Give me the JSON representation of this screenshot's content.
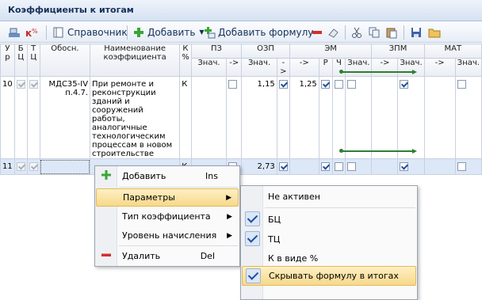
{
  "window": {
    "title": "Коэффициенты к итогам"
  },
  "toolbar": {
    "reference_label": "Справочник",
    "add_label": "Добавить",
    "add_formula_label": "Добавить формулу"
  },
  "grid": {
    "headers": {
      "ur": "У р",
      "bc": "Б Ц",
      "tc": "Т Ц",
      "obosn": "Обосн.",
      "name": "Наименование коэффициента",
      "kpct": "К %",
      "pz": "ПЗ",
      "ozp": "ОЗП",
      "em": "ЭМ",
      "zpm": "ЗПМ",
      "mat": "МАТ",
      "znach": "Знач.",
      "arrow": "->",
      "r": "Р",
      "ch": "Ч"
    },
    "rows": [
      {
        "ur": "10",
        "obosn": "МДС35-IV п.4.7.",
        "name": "При ремонте и реконструкции зданий и сооружений работы, аналогичные технологическим процессам в новом строительстве",
        "k": "К",
        "ozp": "1,15",
        "em": "1,25"
      },
      {
        "ur": "11",
        "obosn": "",
        "name": "",
        "k": "К",
        "ozp": "2,73",
        "em": ""
      }
    ]
  },
  "context_menu": {
    "items": [
      {
        "label": "Добавить",
        "shortcut": "Ins"
      },
      {
        "label": "Параметры"
      },
      {
        "label": "Тип коэффициента"
      },
      {
        "label": "Уровень начисления"
      },
      {
        "label": "Удалить",
        "shortcut": "Del"
      }
    ]
  },
  "submenu": {
    "items": [
      {
        "label": "Не активен",
        "checked": false
      },
      {
        "label": "БЦ",
        "checked": true
      },
      {
        "label": "ТЦ",
        "checked": true
      },
      {
        "label": "К в виде %",
        "checked": false
      },
      {
        "label": "Скрывать формулу в итогах",
        "checked": true
      }
    ]
  },
  "colors": {
    "highlight": "#f7d88a",
    "title_text": "#15305a",
    "formula_line": "#2e7d32"
  }
}
